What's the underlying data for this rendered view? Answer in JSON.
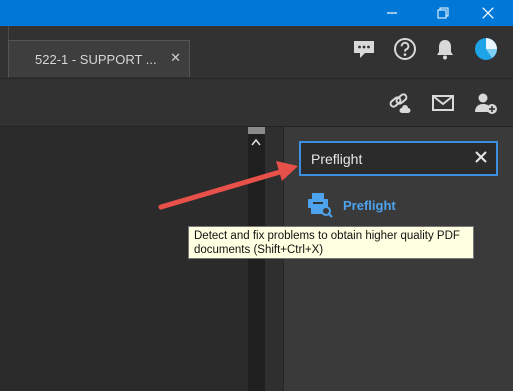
{
  "window": {
    "controls": [
      {
        "name": "minimize-button",
        "icon": "minimize-icon"
      },
      {
        "name": "restore-button",
        "icon": "restore-icon"
      },
      {
        "name": "close-button",
        "icon": "close-icon"
      }
    ]
  },
  "tab": {
    "title": "522-1 - SUPPORT ...",
    "close_glyph": "✕"
  },
  "header_icons": [
    "comment-icon",
    "help-icon",
    "bell-icon",
    "account-icon"
  ],
  "toolbar_icons": [
    "link-icon",
    "email-icon",
    "add-user-icon"
  ],
  "search": {
    "value": "Preflight"
  },
  "results": [
    {
      "label": "Preflight",
      "icon": "preflight-icon"
    }
  ],
  "tooltip": {
    "line1": "Detect and fix problems to obtain higher quality PDF",
    "line2": "documents (Shift+Ctrl+X)"
  },
  "colors": {
    "titlebar": "#0078d7",
    "accent": "#4ea3ee",
    "annotation_arrow": "#e8504a"
  }
}
